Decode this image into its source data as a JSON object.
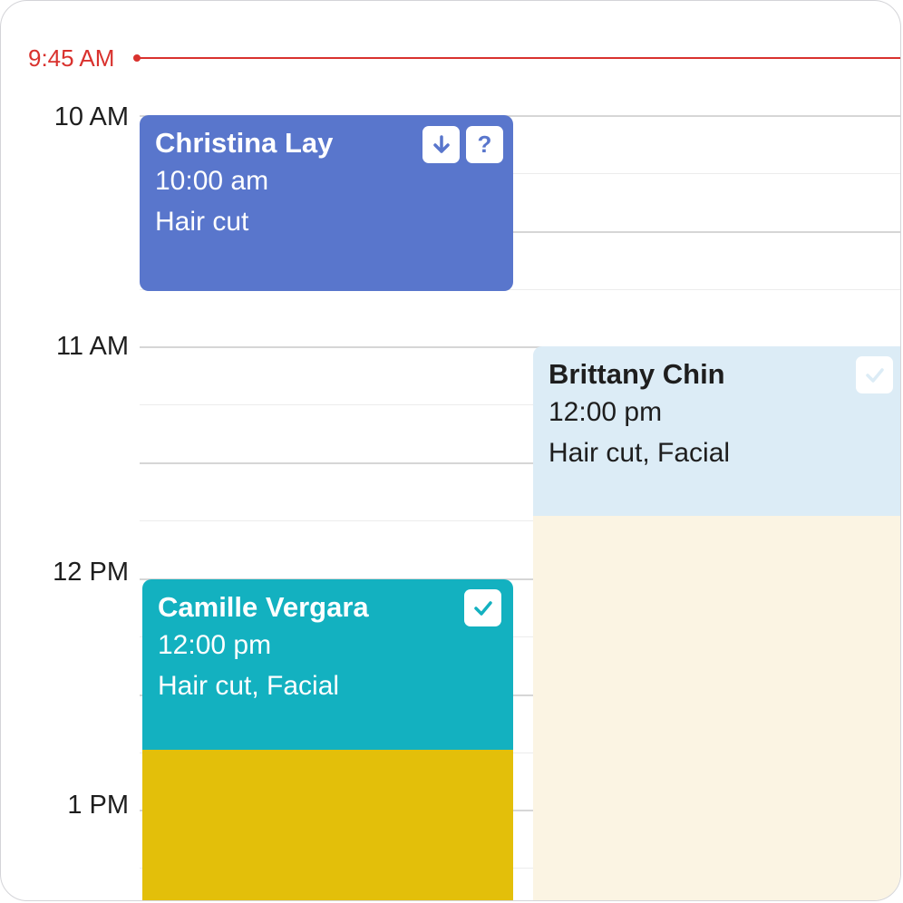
{
  "current_time": "9:45 AM",
  "hours": [
    "10 AM",
    "11 AM",
    "12 PM",
    "1 PM"
  ],
  "events": [
    {
      "name": "Christina Lay",
      "time": "10:00 am",
      "services": "Hair cut",
      "bg": "#5976cc",
      "text": "#ffffff",
      "icons": [
        "arrow-down-icon",
        "question-icon"
      ]
    },
    {
      "name": "Brittany Chin",
      "time": "12:00 pm",
      "services": "Hair cut, Facial",
      "bg": "#dcecf6",
      "text": "#1e1e1e",
      "icons": [
        "check-icon"
      ]
    },
    {
      "name": "Camille Vergara",
      "time": "12:00 pm",
      "services": "Hair cut, Facial",
      "bg": "#13b1c0",
      "text": "#ffffff",
      "icons": [
        "check-icon"
      ]
    }
  ],
  "colors": {
    "now_indicator": "#d9322e",
    "brittany_extension": "#fbf4e3",
    "camille_extension": "#e3bf0a"
  }
}
